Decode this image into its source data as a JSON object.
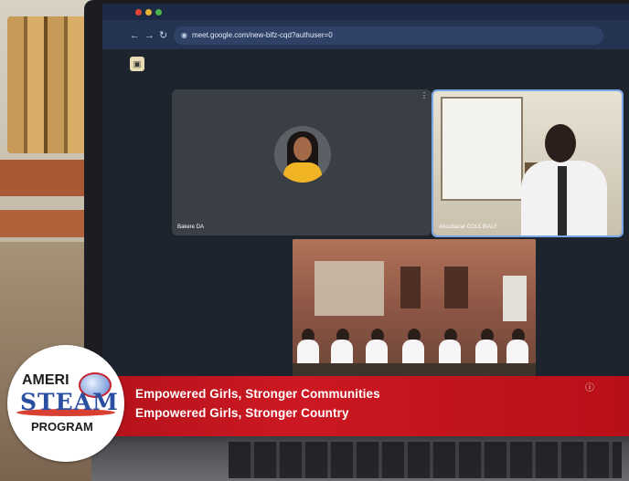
{
  "browser": {
    "url": "meet.google.com/new-bifz-cqd?authuser=0"
  },
  "meeting": {
    "participants": [
      {
        "name": "Bakere DA"
      },
      {
        "name": "Aboubacar COULIBALY"
      }
    ]
  },
  "banner": {
    "line1": "Empowered Girls, Stronger Communities",
    "line2": "Empowered Girls, Stronger Country"
  },
  "logo": {
    "top": "AMERI",
    "middle": "STEAM",
    "bottom": "PROGRAM"
  },
  "colors": {
    "banner_red": "#c4141e",
    "logo_blue": "#2a4ea0",
    "meet_bg": "#1e242e"
  }
}
